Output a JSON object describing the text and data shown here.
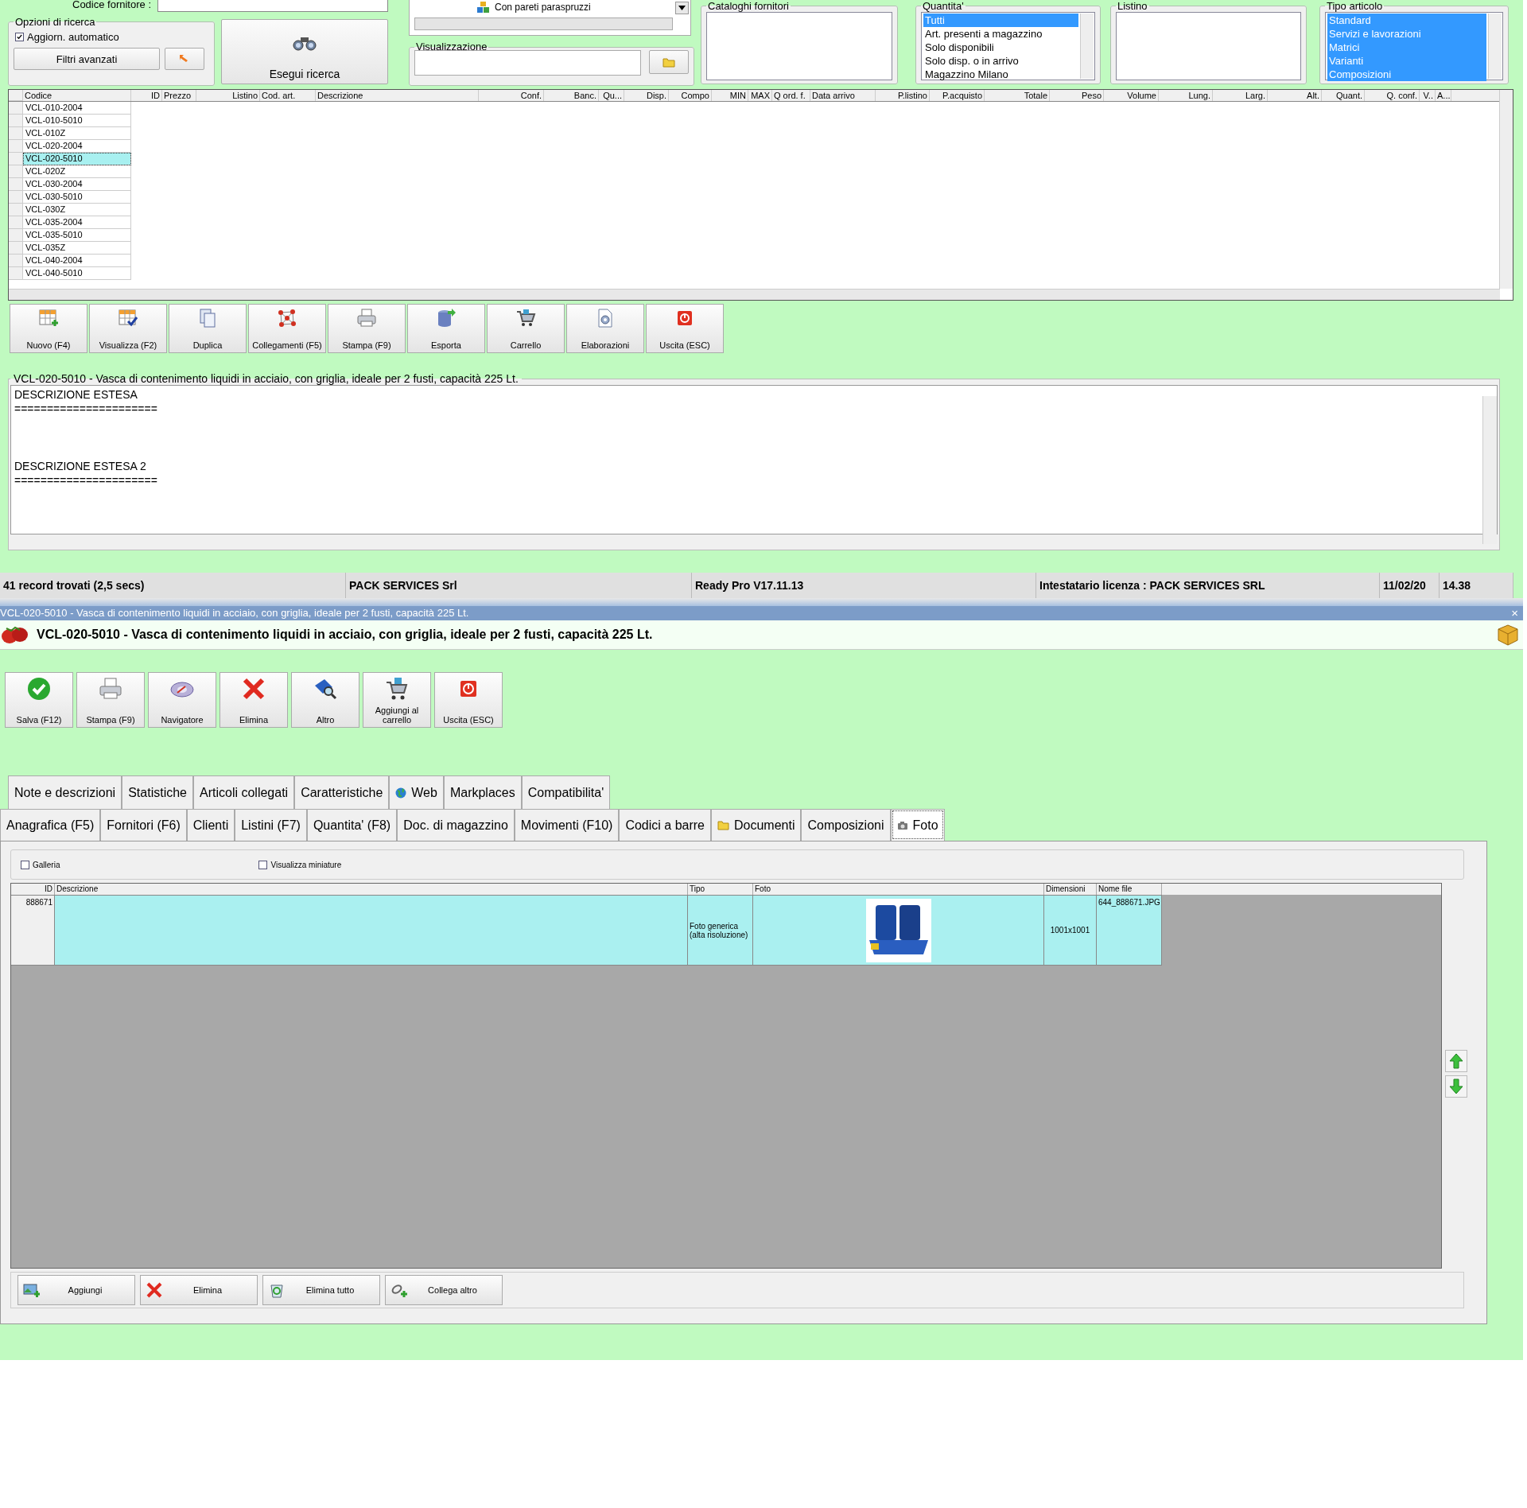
{
  "search_panel": {
    "supplier_code_label": "Codice fornitore :",
    "options_group": {
      "title": "Opzioni di ricerca",
      "auto_update": {
        "label": "Aggiorn. automatico",
        "checked": true
      },
      "advanced_filters_button": "Filtri avanzati"
    },
    "search_button": "Esegui ricerca",
    "tree_item": "Con pareti paraspruzzi",
    "view_group": {
      "title": "Visualizzazione"
    },
    "filters": [
      {
        "title": "Cataloghi fornitori"
      },
      {
        "title": "Quantita'",
        "items": [
          {
            "label": "Tutti",
            "selected": true
          },
          {
            "label": "Art. presenti a magazzino",
            "selected": false
          },
          {
            "label": "Solo disponibili",
            "selected": false
          },
          {
            "label": "Solo disp. o in arrivo",
            "selected": false
          },
          {
            "label": "Magazzino Milano",
            "selected": false
          }
        ]
      },
      {
        "title": "Listino"
      },
      {
        "title": "Tipo articolo",
        "items": [
          {
            "label": "Standard",
            "selected": true
          },
          {
            "label": "Servizi e lavorazioni",
            "selected": true
          },
          {
            "label": "Matrici",
            "selected": true
          },
          {
            "label": "Varianti",
            "selected": true
          },
          {
            "label": "Composizioni",
            "selected": true
          }
        ]
      }
    ]
  },
  "grid": {
    "columns": [
      "Codice",
      "ID",
      "Prezzo",
      "Listino",
      "Cod. art.",
      "Descrizione",
      "Conf.",
      "Banc.",
      "Qu...",
      "Disp.",
      "Compo",
      "MIN",
      "MAX",
      "Q ord. f.",
      "Data arrivo",
      "P.listino",
      "P.acquisto",
      "Totale",
      "Peso",
      "Volume",
      "Lung.",
      "Larg.",
      "Alt.",
      "Quant.",
      "Q. conf.",
      "V..",
      "A..."
    ],
    "rows": [
      {
        "code": "VCL-010-2004",
        "selected": false
      },
      {
        "code": "VCL-010-5010",
        "selected": false
      },
      {
        "code": "VCL-010Z",
        "selected": false
      },
      {
        "code": "VCL-020-2004",
        "selected": false
      },
      {
        "code": "VCL-020-5010",
        "selected": true
      },
      {
        "code": "VCL-020Z",
        "selected": false
      },
      {
        "code": "VCL-030-2004",
        "selected": false
      },
      {
        "code": "VCL-030-5010",
        "selected": false
      },
      {
        "code": "VCL-030Z",
        "selected": false
      },
      {
        "code": "VCL-035-2004",
        "selected": false
      },
      {
        "code": "VCL-035-5010",
        "selected": false
      },
      {
        "code": "VCL-035Z",
        "selected": false
      },
      {
        "code": "VCL-040-2004",
        "selected": false
      },
      {
        "code": "VCL-040-5010",
        "selected": false
      }
    ]
  },
  "toolbar": [
    "Nuovo (F4)",
    "Visualizza (F2)",
    "Duplica",
    "Collegamenti (F5)",
    "Stampa (F9)",
    "Esporta",
    "Carrello",
    "Elaborazioni",
    "Uscita (ESC)"
  ],
  "description": {
    "title": "VCL-020-5010 - Vasca di contenimento liquidi in acciaio, con griglia, ideale per 2 fusti, capacità 225 Lt.",
    "text": "DESCRIZIONE ESTESA\n======================\n\n\n\nDESCRIZIONE ESTESA 2\n======================"
  },
  "status_bar": [
    "41 record trovati (2,5 secs)",
    "PACK SERVICES Srl",
    "Ready Pro V17.11.13",
    "Intestatario licenza : PACK SERVICES SRL",
    "11/02/20",
    "14.38"
  ],
  "detail": {
    "window_title": "VCL-020-5010 - Vasca di contenimento liquidi in acciaio, con griglia, ideale per 2 fusti, capacità 225 Lt.",
    "close": "×",
    "heading": "VCL-020-5010 - Vasca di contenimento liquidi in acciaio, con griglia, ideale per 2 fusti, capacità 225 Lt.",
    "buttons": [
      "Salva (F12)",
      "Stampa (F9)",
      "Navigatore",
      "Elimina",
      "Altro",
      "Aggiungi al carrello",
      "Uscita (ESC)"
    ],
    "tabs_row1": [
      {
        "label": "Note e descrizioni",
        "selected": false
      },
      {
        "label": "Statistiche",
        "selected": false
      },
      {
        "label": "Articoli collegati",
        "selected": false
      },
      {
        "label": "Caratteristiche",
        "selected": false
      },
      {
        "label": "Web",
        "selected": false
      },
      {
        "label": "Markplaces",
        "selected": false
      },
      {
        "label": "Compatibilita'",
        "selected": false
      }
    ],
    "tabs_row2": [
      {
        "label": "Anagrafica (F5)",
        "selected": false
      },
      {
        "label": "Fornitori (F6)",
        "selected": false
      },
      {
        "label": "Clienti",
        "selected": false
      },
      {
        "label": "Listini (F7)",
        "selected": false
      },
      {
        "label": "Quantita' (F8)",
        "selected": false
      },
      {
        "label": "Doc. di magazzino",
        "selected": false
      },
      {
        "label": "Movimenti (F10)",
        "selected": false
      },
      {
        "label": "Codici a barre",
        "selected": false
      },
      {
        "label": "Documenti",
        "selected": false
      },
      {
        "label": "Composizioni",
        "selected": false
      },
      {
        "label": "Foto",
        "selected": true
      }
    ],
    "gallery": {
      "label": "Galleria",
      "checked": false
    },
    "thumbnails": {
      "label": "Visualizza miniature",
      "checked": false
    },
    "photo_table": {
      "columns": [
        "ID",
        "Descrizione",
        "Tipo",
        "Foto",
        "Dimensioni",
        "Nome file"
      ],
      "rows": [
        {
          "id": "888671",
          "type": "Foto generica (alta risoluzione)",
          "dimensions": "1001x1001",
          "file": "644_888671.JPG",
          "selected": true
        }
      ]
    },
    "bottom_buttons": [
      "Aggiungi",
      "Elimina",
      "Elimina tutto",
      "Collega altro"
    ]
  }
}
